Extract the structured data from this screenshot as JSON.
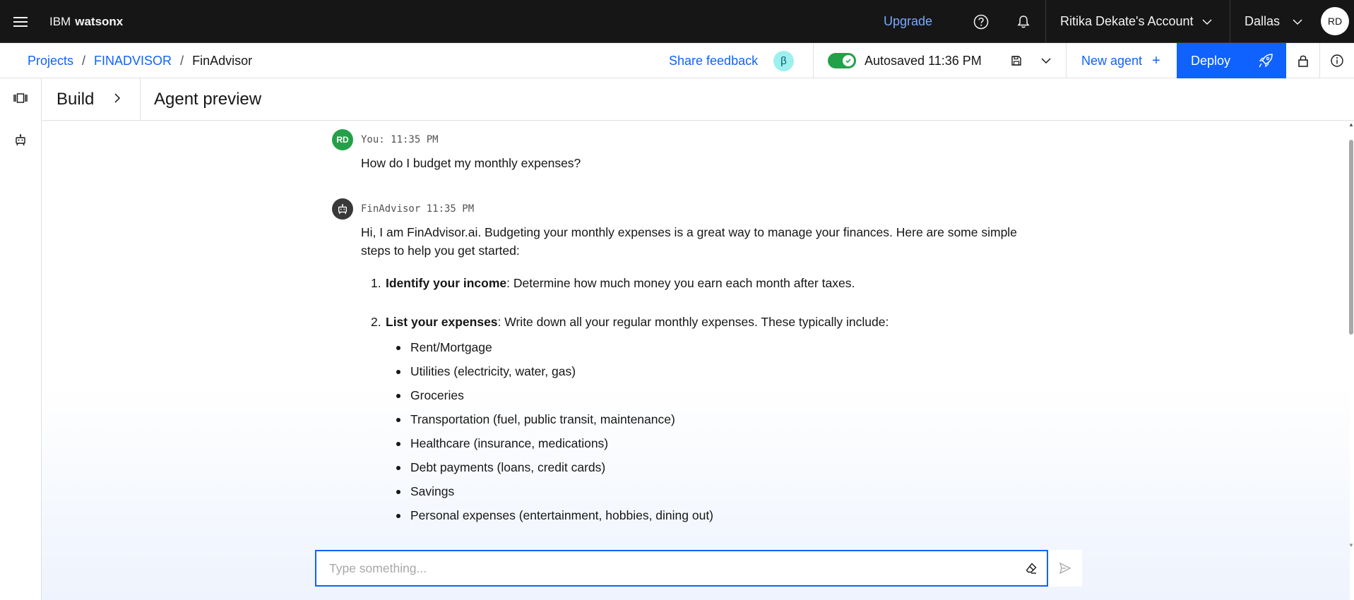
{
  "header": {
    "brand_prefix": "IBM",
    "brand_name": "watsonx",
    "upgrade_label": "Upgrade",
    "account_label": "Ritika Dekate's Account",
    "region_label": "Dallas",
    "avatar_initials": "RD",
    "icons": [
      "menu-icon",
      "help-icon",
      "notification-icon",
      "chevron-down-icon"
    ]
  },
  "subheader": {
    "breadcrumbs": [
      "Projects",
      "FINADVISOR",
      "FinAdvisor"
    ],
    "breadcrumb_separator": "/",
    "share_feedback": "Share feedback",
    "beta_badge": "β",
    "autosave_text": "Autosaved 11:36 PM",
    "new_agent_label": "New agent",
    "new_agent_plus": "+",
    "deploy_label": "Deploy"
  },
  "panel": {
    "build_label": "Build",
    "preview_title": "Agent preview"
  },
  "messages": {
    "user": {
      "avatar": "RD",
      "meta": "You: 11:35 PM",
      "text": "How do I budget my monthly expenses?"
    },
    "bot": {
      "meta": "FinAdvisor 11:35 PM",
      "intro": "Hi, I am FinAdvisor.ai. Budgeting your monthly expenses is a great way to manage your finances. Here are some simple steps to help you get started:",
      "steps": [
        {
          "num": "1.",
          "title": "Identify your income",
          "text": ": Determine how much money you earn each month after taxes."
        },
        {
          "num": "2.",
          "title": "List your expenses",
          "text": ": Write down all your regular monthly expenses. These typically include:"
        }
      ],
      "expenses": [
        "Rent/Mortgage",
        "Utilities (electricity, water, gas)",
        "Groceries",
        "Transportation (fuel, public transit, maintenance)",
        "Healthcare (insurance, medications)",
        "Debt payments (loans, credit cards)",
        "Savings",
        "Personal expenses (entertainment, hobbies, dining out)"
      ]
    }
  },
  "composer": {
    "placeholder": "Type something..."
  },
  "colors": {
    "header_bg": "#161616",
    "accent_blue": "#0f62fe",
    "link_light_blue": "#78a9ff",
    "toggle_green": "#24a148",
    "user_avatar_green": "#24a148",
    "beta_badge_bg": "#9ef0f0"
  }
}
